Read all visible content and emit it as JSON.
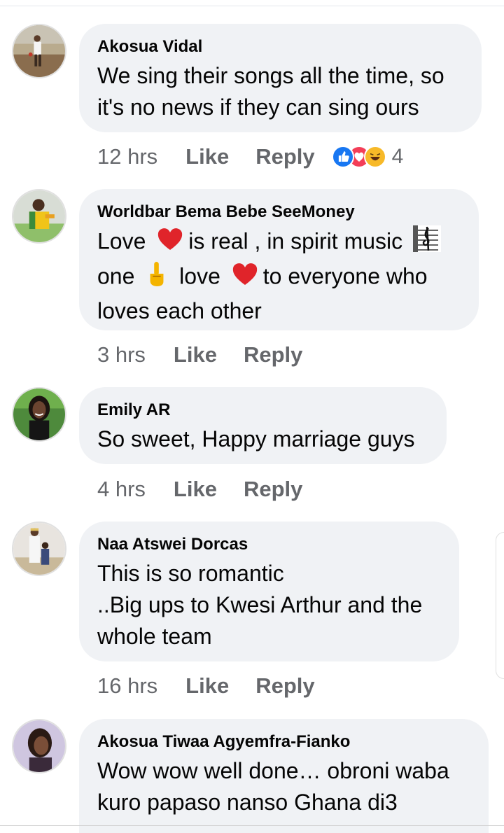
{
  "comments": [
    {
      "author": "Akosua Vidal",
      "lines": [
        "We sing their songs all the time, so",
        "it's no news if they can sing ours"
      ],
      "time": "12 hrs",
      "like_label": "Like",
      "reply_label": "Reply",
      "reactions": [
        "like-reaction-icon",
        "love-reaction-icon",
        "haha-reaction-icon"
      ],
      "reaction_count": "4"
    },
    {
      "author": "Worldbar Bema Bebe SeeMoney",
      "lines": [
        "Love",
        "is real ,  in spirit music",
        "one",
        "love",
        "to everyone who",
        "loves each other"
      ],
      "time": "3 hrs",
      "like_label": "Like",
      "reply_label": "Reply"
    },
    {
      "author": "Emily AR",
      "lines": [
        "So sweet, Happy marriage guys"
      ],
      "time": "4 hrs",
      "like_label": "Like",
      "reply_label": "Reply"
    },
    {
      "author": "Naa Atswei Dorcas",
      "lines": [
        "This is so romantic",
        "..Big ups to Kwesi Arthur and the",
        "whole team"
      ],
      "time": "16 hrs",
      "like_label": "Like",
      "reply_label": "Reply"
    },
    {
      "author": "Akosua Tiwaa Agyemfra-Fianko",
      "lines": [
        "Wow wow well done… obroni waba",
        "kuro papaso nanso Ghana di3"
      ]
    }
  ],
  "colors": {
    "bubble": "#f0f2f5",
    "meta_text": "#65676b",
    "text": "#050505",
    "like_blue": "#1877f2",
    "love_red": "#f33e58",
    "haha_yellow": "#f7b928"
  }
}
